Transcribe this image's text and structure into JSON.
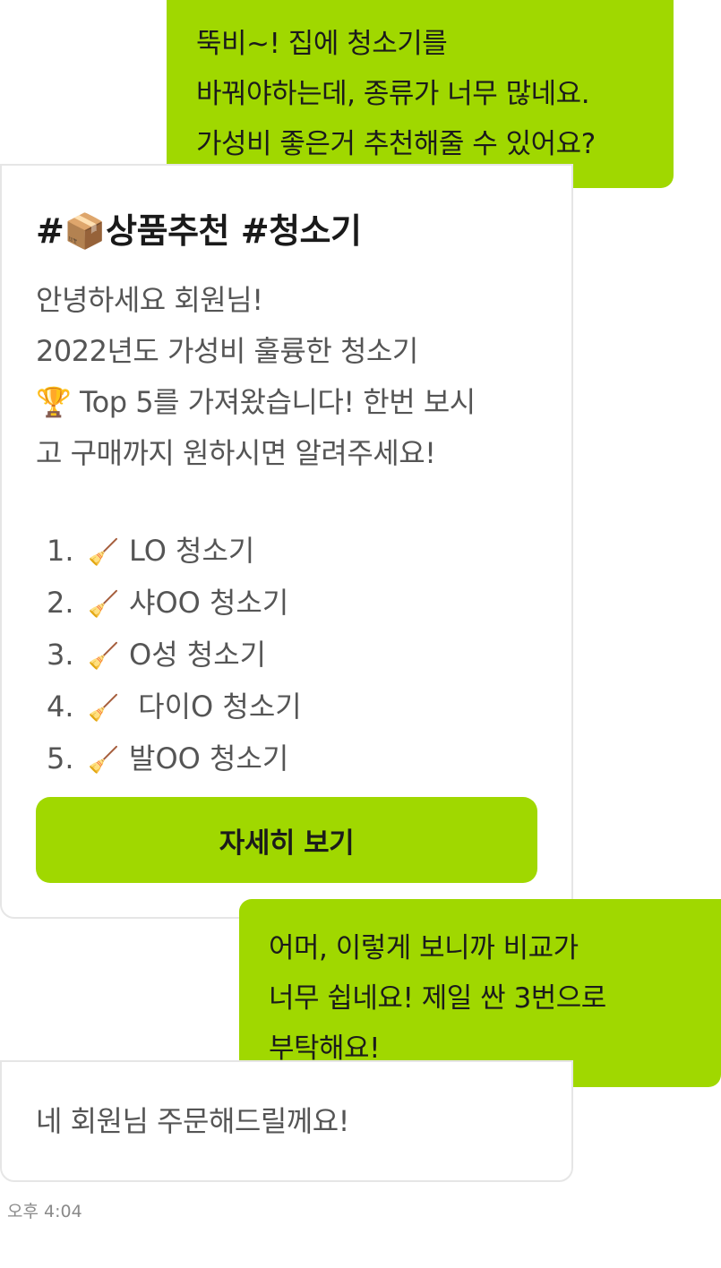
{
  "messages": {
    "user_1": {
      "lines": [
        "뚝비~! 집에 청소기를",
        "바꿔야하는데, 종류가 너무 많네요.",
        "가성비 좋은거 추천해줄 수 있어요?"
      ]
    },
    "bot_card": {
      "title": "#📦상품추천 #청소기",
      "body_lines": [
        "안녕하세요 회원님!",
        "2022년도 가성비 훌륭한 청소기",
        "🏆 Top 5를 가져왔습니다! 한번 보시",
        "고 구매까지 원하시면 알려주세요!"
      ],
      "items": [
        {
          "num": "1.",
          "icon": "🧹",
          "icon_name": "broom-icon",
          "label": "LO 청소기"
        },
        {
          "num": "2.",
          "icon": "🧹",
          "icon_name": "broom-icon",
          "label": "샤OO 청소기"
        },
        {
          "num": "3.",
          "icon": "🧹",
          "icon_name": "broom-icon",
          "label": "O성 청소기"
        },
        {
          "num": "4.",
          "icon": "🧹",
          "icon_name": "broom-icon",
          "label": " 다이O 청소기"
        },
        {
          "num": "5.",
          "icon": "🧹",
          "icon_name": "broom-icon",
          "label": "발OO 청소기"
        }
      ],
      "button_label": "자세히 보기"
    },
    "user_2": {
      "lines": [
        "어머, 이렇게 보니까 비교가",
        "너무 쉽네요! 제일 싼 3번으로",
        "부탁해요!"
      ]
    },
    "bot_2": {
      "text": "네 회원님 주문해드릴께요!"
    }
  },
  "timestamp": "오후 4:04",
  "colors": {
    "accent": "#a0d800",
    "bot_border": "#e6e6e6",
    "bot_text": "#555555",
    "timestamp": "#8a8a8a"
  }
}
